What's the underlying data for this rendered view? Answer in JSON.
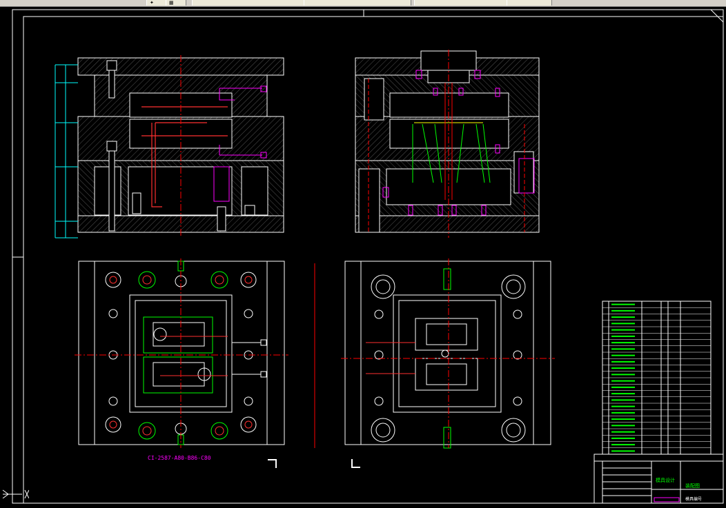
{
  "toolbar": {
    "tabs": [
      "",
      "",
      "",
      "",
      ""
    ],
    "icons": [
      "snap-icon",
      "grid-icon"
    ]
  },
  "drawing": {
    "part_label": "CI-2587-A80-B86-C80",
    "title_block": {
      "company": "模具设计",
      "drawing_name": "装配图",
      "drawing_no": "模具编号"
    },
    "colors": {
      "background": "#000000",
      "frame": "#ffffff",
      "outline": "#ffffff",
      "center_line": "#ff0000",
      "dimension": "#00ffff",
      "part": "#00ff00",
      "hatch": "#808080",
      "magenta": "#ff00ff",
      "yellow": "#ffff00"
    },
    "views": [
      "front-section-view",
      "side-section-view",
      "fixed-half-plan-view",
      "moving-half-plan-view"
    ]
  },
  "bom": {
    "rows": [
      "",
      "",
      "",
      "",
      "",
      "",
      "",
      "",
      "",
      "",
      "",
      "",
      "",
      "",
      "",
      "",
      "",
      "",
      "",
      "",
      "",
      "",
      "",
      ""
    ]
  }
}
